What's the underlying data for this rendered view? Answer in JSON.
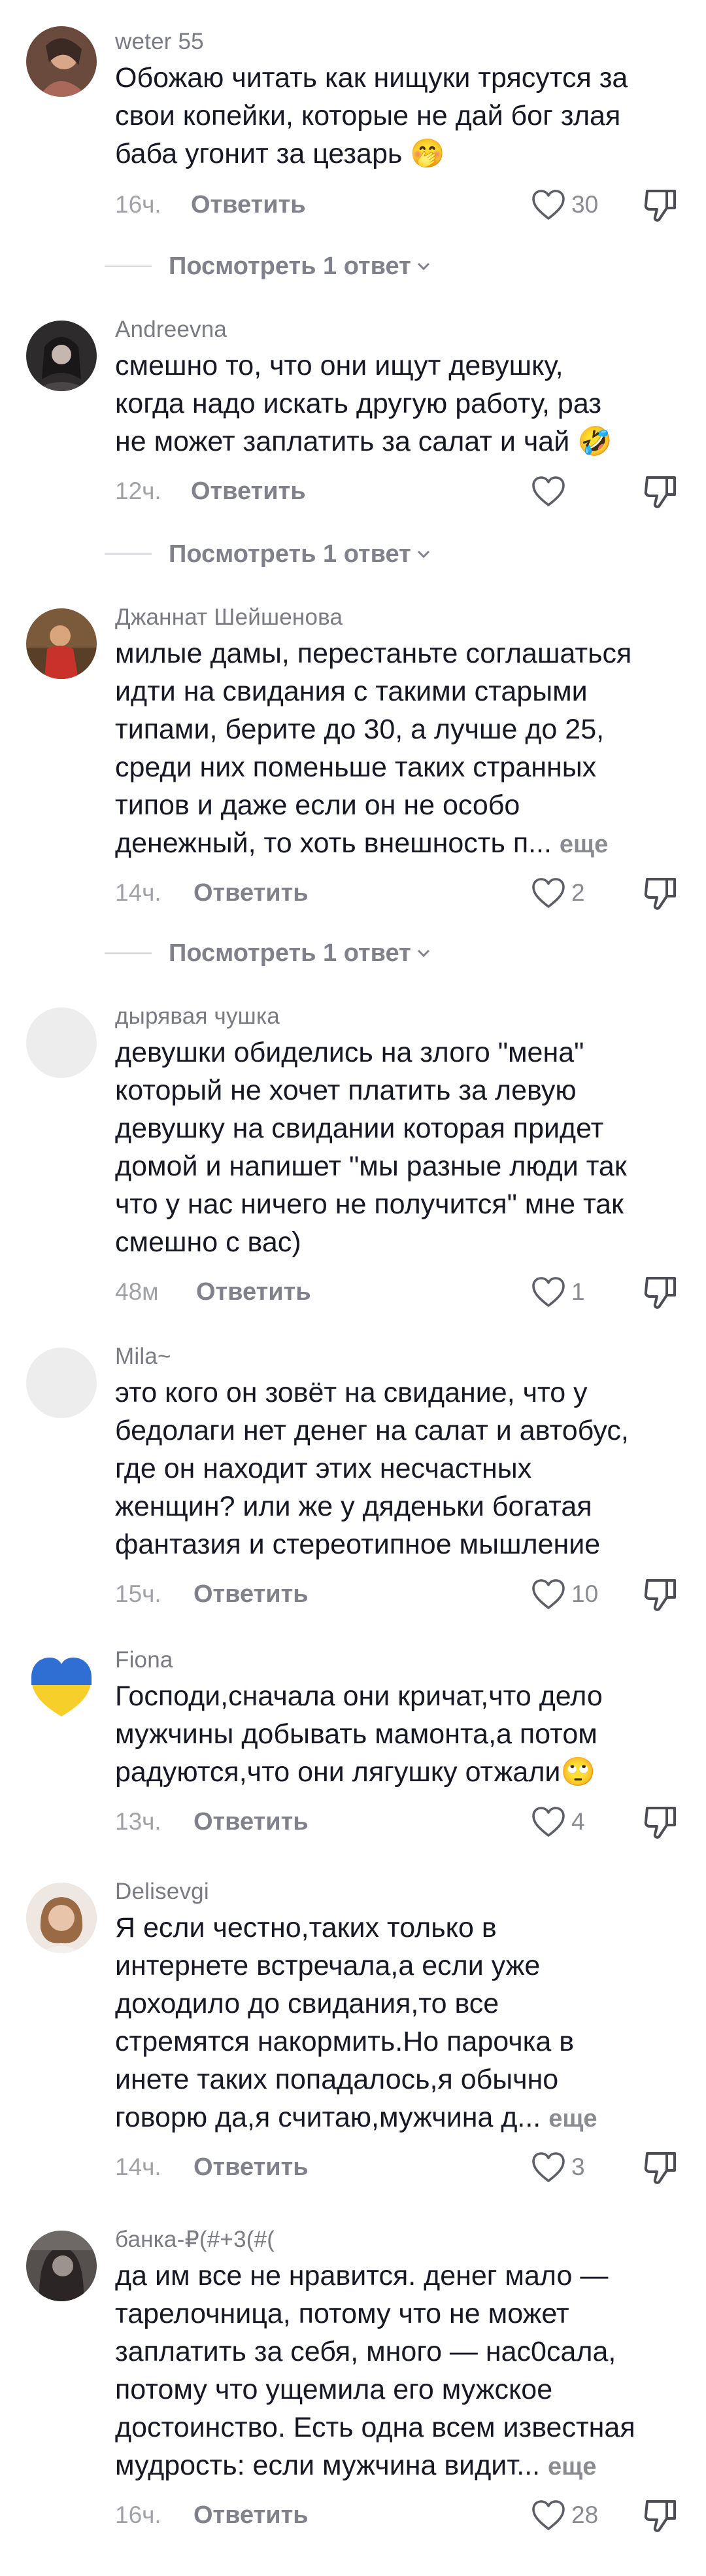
{
  "labels": {
    "reply": "Ответить",
    "more": "еще",
    "view_replies": "Посмотреть 1 ответ"
  },
  "comments": [
    {
      "username": "weter 55",
      "lines": [
        "Обожаю читать как нищуки трясутся за",
        "свои копейки, которые не дай бог злая",
        "баба угонит за цезарь 🤭"
      ],
      "time": "16ч.",
      "likes": "30",
      "has_replies": true
    },
    {
      "username": "Andreevna",
      "lines": [
        "смешно то, что они ищут девушку,",
        "когда надо искать другую работу, раз",
        "не может заплатить за салат и чай 🤣"
      ],
      "time": "12ч.",
      "likes": "",
      "has_replies": true
    },
    {
      "username": "Джаннат Шейшенова",
      "lines": [
        "милые дамы, перестаньте соглашаться",
        "идти на свидания с такими старыми",
        "типами, берите до 30, а лучше до 25,",
        "среди них поменьше таких странных",
        "типов и даже если он не особо",
        "денежный, то хоть внешность п..."
      ],
      "truncated": true,
      "time": "14ч.",
      "likes": "2",
      "has_replies": true
    },
    {
      "username": "дырявая чушка",
      "lines": [
        "девушки обиделись на злого \"мена\"",
        "который не хочет платить за левую",
        "девушку на свидании которая придет",
        "домой и напишет \"мы разные люди так",
        "что у нас ничего не получится\" мне так",
        "смешно с вас)"
      ],
      "time": "48м",
      "likes": "1",
      "has_replies": false
    },
    {
      "username": "Mila~",
      "lines": [
        "это кого он зовёт на свидание, что у",
        "бедолаги нет денег на салат и автобус,",
        "где он находит этих несчастных",
        "женщин? или же у дяденьки богатая",
        "фантазия и стереотипное мышление"
      ],
      "time": "15ч.",
      "likes": "10",
      "has_replies": false
    },
    {
      "username": "Fiona",
      "lines": [
        "Господи,сначала они кричат,что дело",
        "мужчины добывать мамонта,а потом",
        "радуются,что они лягушку отжали🙄"
      ],
      "time": "13ч.",
      "likes": "4",
      "has_replies": false
    },
    {
      "username": "Delisevgi",
      "lines": [
        "Я если честно,таких только в",
        "интернете встречала,а если уже",
        "доходило до свидания,то все",
        "стремятся накормить.Но парочка в",
        "инете таких попадалось,я обычно",
        "говорю да,я считаю,мужчина д..."
      ],
      "truncated": true,
      "time": "14ч.",
      "likes": "3",
      "has_replies": false
    },
    {
      "username": "банка-₽(#+3(#(",
      "lines": [
        "да им все не нравится. денег мало —",
        "тарелочница, потому что не может",
        "заплатить за себя, много — нас0сала,",
        "потому что ущемила его мужское",
        "достоинство. Есть одна всем известная",
        "мудрость: если мужчина видит..."
      ],
      "truncated": true,
      "time": "16ч.",
      "likes": "28",
      "has_replies": false
    }
  ]
}
